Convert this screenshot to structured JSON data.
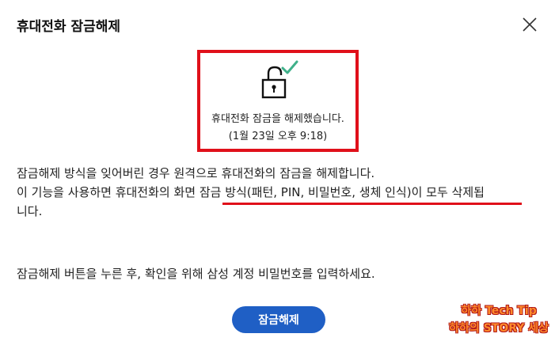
{
  "dialog": {
    "title": "휴대전화 잠금해제",
    "close_icon": "close-icon"
  },
  "status": {
    "icon": "unlocked-padlock-check-icon",
    "message": "휴대전화 잠금을 해제했습니다.",
    "timestamp": "(1월 23일 오후 9:18)",
    "highlight_color": "#e0101a",
    "check_color": "#3fb08a"
  },
  "description": {
    "line1": "잠금해제 방식을 잊어버린 경우 원격으로 휴대전화의 잠금을 해제합니다.",
    "line2_prefix": "이 기능을 사용하면 휴대전화의 화면 ",
    "line2_highlight": "잠금 방식(패턴, PIN, 비밀번호, 생체 인식)이 모두 삭제됩",
    "line3": "니다."
  },
  "instruction": "잠금해제 버튼을 누른 후, 확인을 위해 삼성 계정 비밀번호를 입력하세요.",
  "unlock_button": {
    "label": "잠금해제",
    "color": "#1f5fc5"
  },
  "watermark": {
    "line1": "하하 Tech Tip",
    "line2": "하하의 STORY 세상"
  }
}
